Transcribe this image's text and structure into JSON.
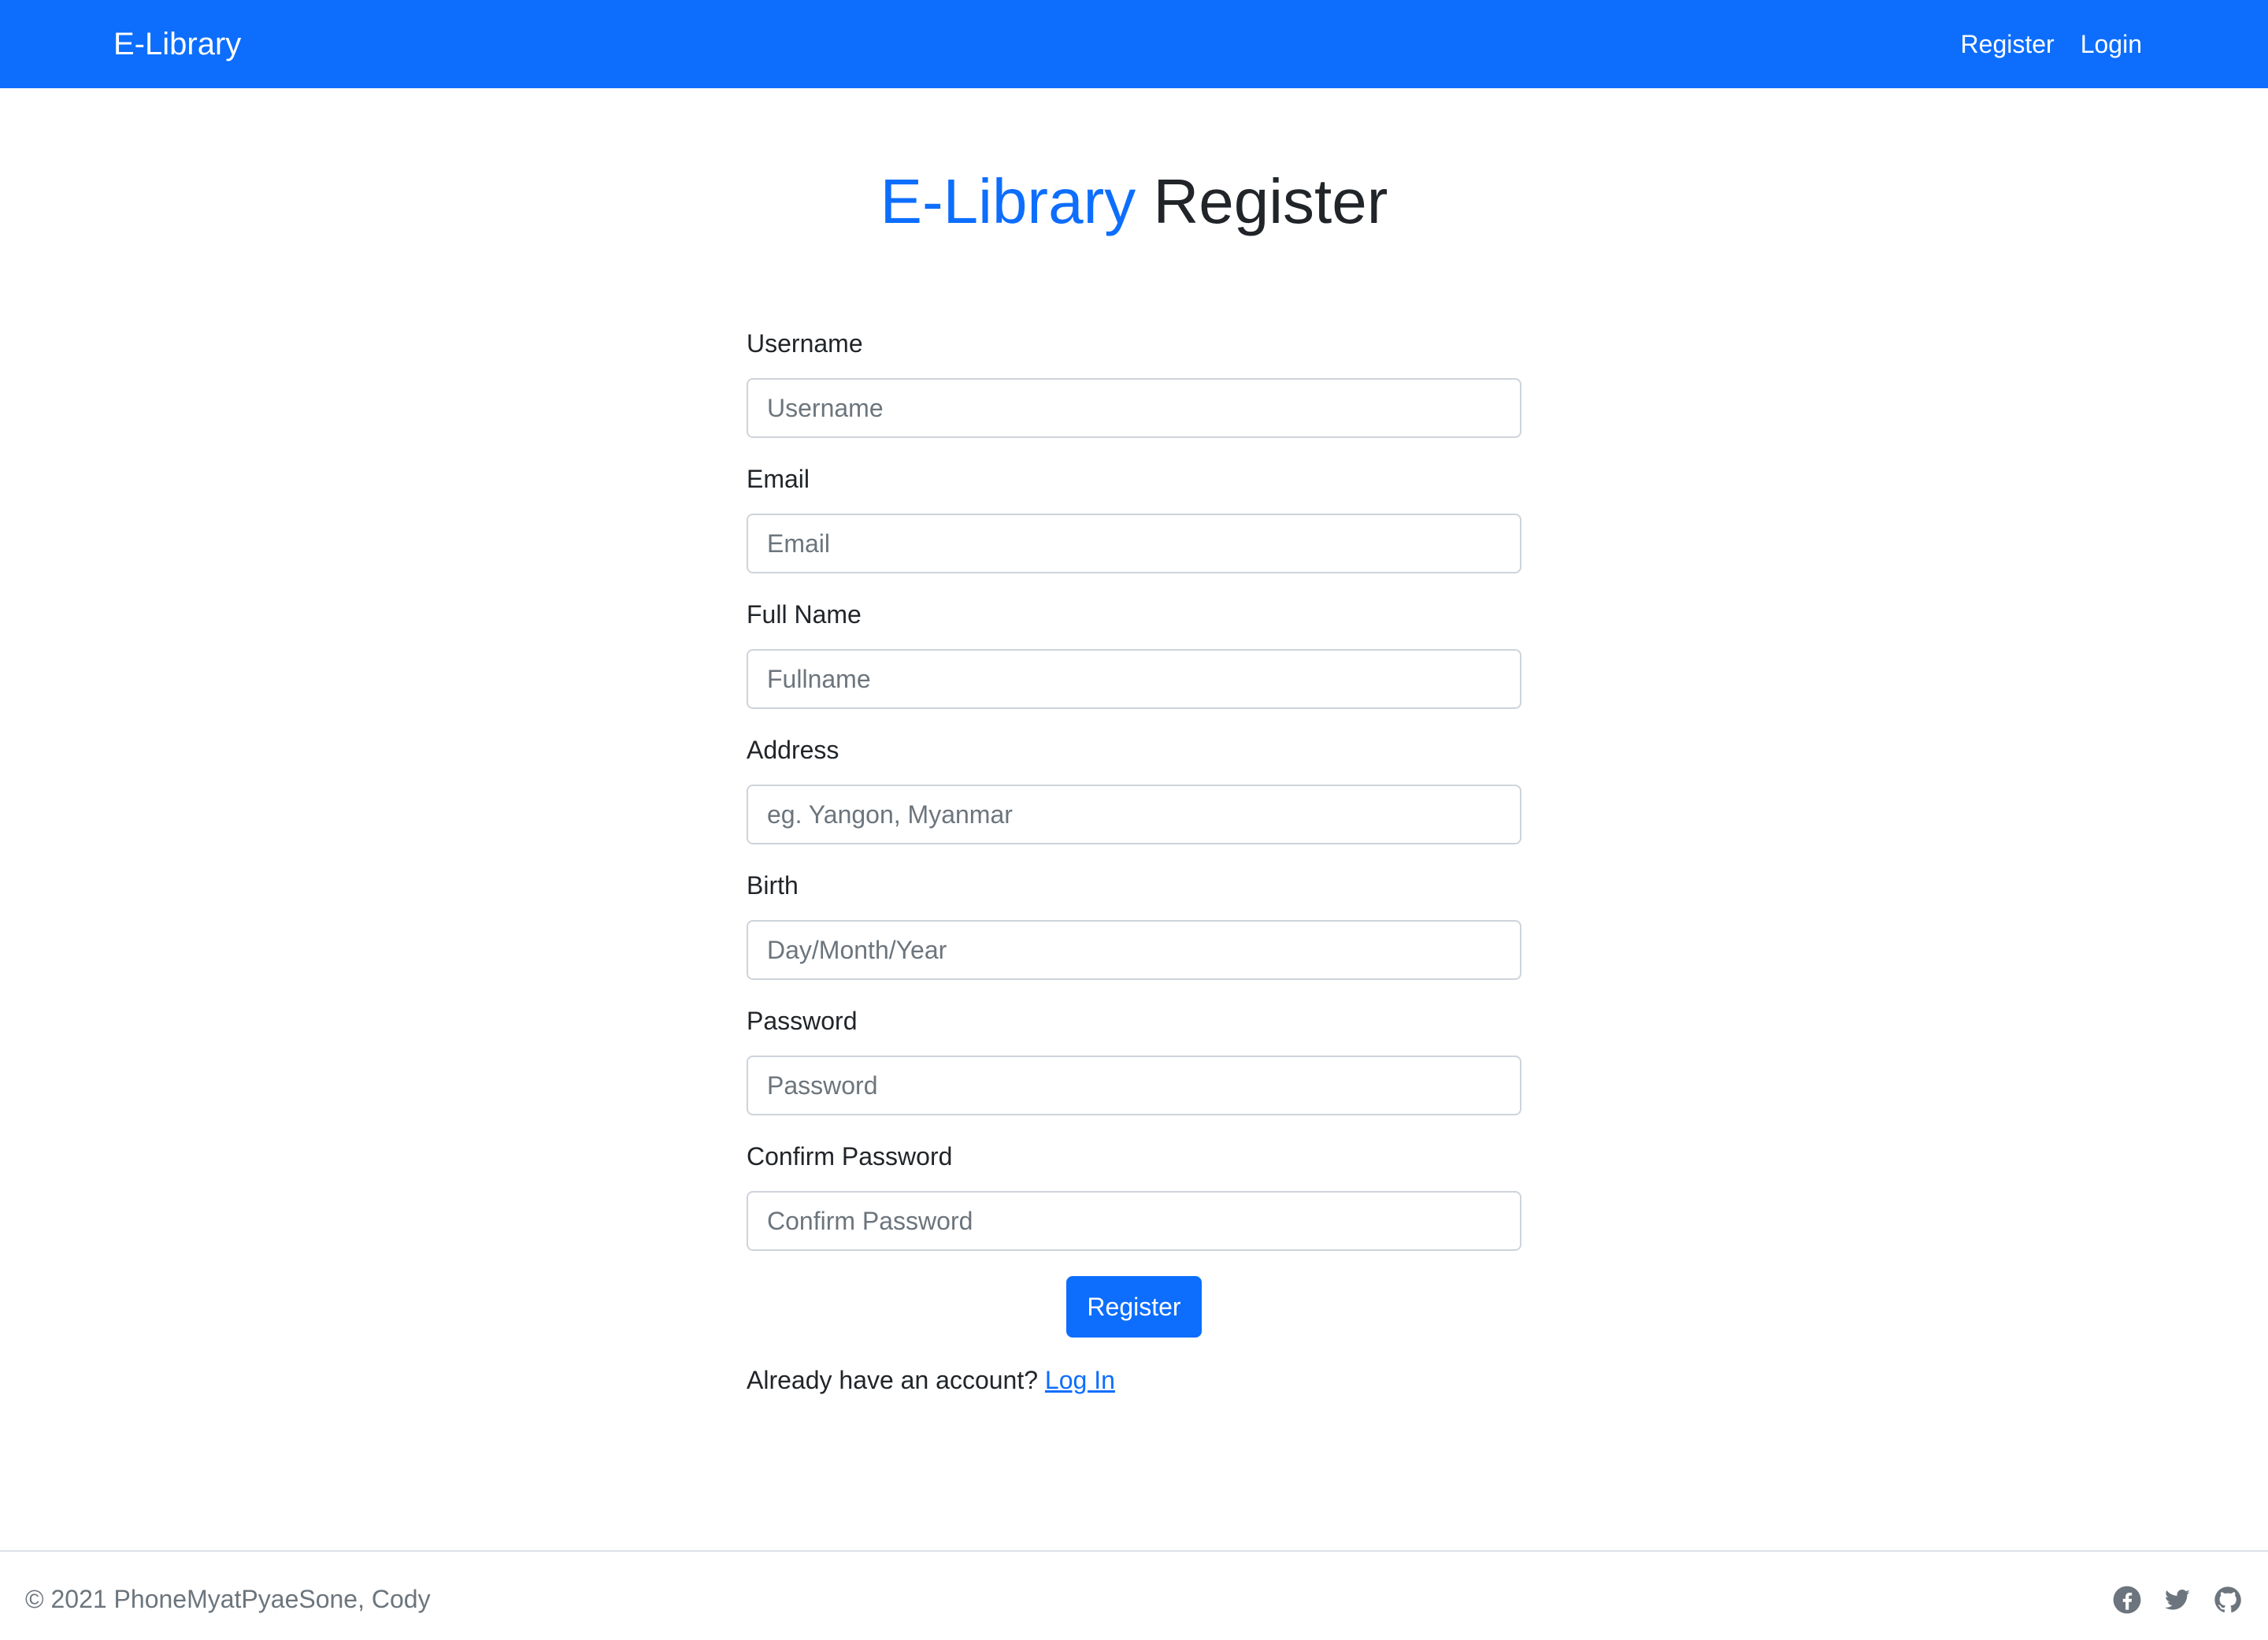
{
  "navbar": {
    "brand": "E-Library",
    "links": [
      "Register",
      "Login"
    ]
  },
  "title": {
    "accent": "E-Library",
    "rest": "Register"
  },
  "form": {
    "fields": [
      {
        "label": "Username",
        "placeholder": "Username"
      },
      {
        "label": "Email",
        "placeholder": "Email"
      },
      {
        "label": "Full Name",
        "placeholder": "Fullname"
      },
      {
        "label": "Address",
        "placeholder": "eg. Yangon, Myanmar"
      },
      {
        "label": "Birth",
        "placeholder": "Day/Month/Year"
      },
      {
        "label": "Password",
        "placeholder": "Password"
      },
      {
        "label": "Confirm Password",
        "placeholder": "Confirm Password"
      }
    ],
    "submit_label": "Register",
    "account_prompt": "Already have an account?",
    "login_link": "Log In"
  },
  "footer": {
    "copyright": "© 2021 PhoneMyatPyaeSone, Cody",
    "social_icons": [
      "facebook-icon",
      "twitter-icon",
      "github-icon"
    ]
  },
  "colors": {
    "primary": "#0d6efd",
    "text": "#212529",
    "muted": "#6c757d",
    "border": "#ced4da"
  }
}
